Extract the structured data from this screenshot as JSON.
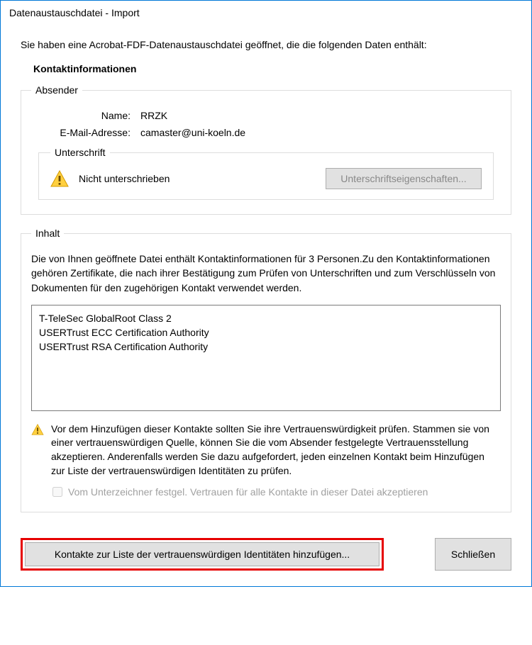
{
  "window": {
    "title": "Datenaustauschdatei - Import"
  },
  "intro": "Sie haben eine Acrobat-FDF-Datenaustauschdatei geöffnet, die die folgenden Daten enthält:",
  "contactinfo_heading": "Kontaktinformationen",
  "sender": {
    "legend": "Absender",
    "name_label": "Name:",
    "name_value": "RRZK",
    "email_label": "E-Mail-Adresse:",
    "email_value": "camaster@uni-koeln.de"
  },
  "signature": {
    "legend": "Unterschrift",
    "status": "Nicht unterschrieben",
    "props_button": "Unterschriftseigenschaften..."
  },
  "content": {
    "legend": "Inhalt",
    "description": "Die von Ihnen geöffnete Datei enthält Kontaktinformationen für 3 Personen.Zu den Kontaktinformationen gehören Zertifikate, die nach ihrer Bestätigung zum Prüfen von Unterschriften und zum Verschlüsseln von Dokumenten für den zugehörigen Kontakt verwendet werden.",
    "certificates": [
      "T-TeleSec GlobalRoot Class 2",
      "USERTrust ECC Certification Authority",
      "USERTrust RSA Certification Authority"
    ],
    "warning": "Vor dem Hinzufügen dieser Kontakte sollten Sie ihre Vertrauenswürdigkeit prüfen. Stammen sie von einer vertrauenswürdigen Quelle, können Sie die vom Absender festgelegte Vertrauensstellung akzeptieren. Anderenfalls werden Sie dazu aufgefordert, jeden einzelnen Kontakt beim Hinzufügen zur Liste der vertrauenswürdigen Identitäten zu prüfen.",
    "checkbox_label": "Vom Unterzeichner festgel. Vertrauen für alle Kontakte in dieser Datei akzeptieren"
  },
  "footer": {
    "add_button": "Kontakte zur Liste der vertrauenswürdigen Identitäten hinzufügen...",
    "close_button": "Schließen"
  }
}
